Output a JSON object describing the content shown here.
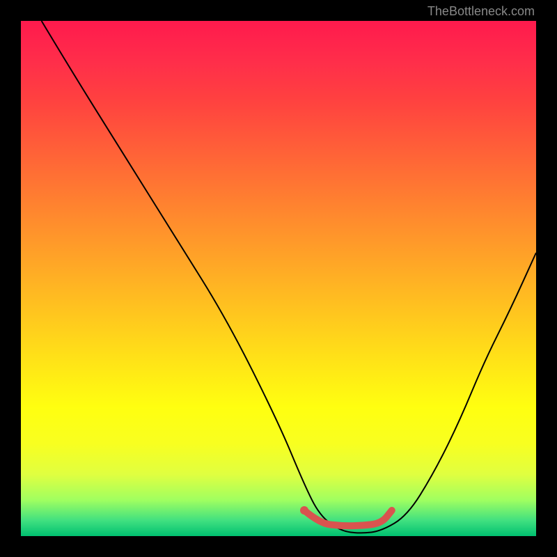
{
  "attribution": "TheBottleneck.com",
  "chart_data": {
    "type": "line",
    "title": "",
    "xlabel": "",
    "ylabel": "",
    "xlim": [
      0,
      100
    ],
    "ylim": [
      0,
      100
    ],
    "series": [
      {
        "name": "bottleneck-curve",
        "x": [
          4,
          10,
          20,
          30,
          40,
          50,
          55,
          58,
          62,
          66,
          70,
          75,
          80,
          85,
          90,
          95,
          100
        ],
        "y": [
          100,
          90,
          74,
          58,
          42,
          22,
          10,
          4,
          1,
          0.5,
          1,
          4,
          12,
          22,
          34,
          44,
          55
        ],
        "color": "#000000"
      },
      {
        "name": "optimal-range-marker",
        "x": [
          55,
          58,
          62,
          66,
          70,
          72
        ],
        "y": [
          5,
          2.5,
          2,
          2,
          2.5,
          5
        ],
        "color": "#d9534f"
      }
    ],
    "gradient_stops": [
      {
        "pos": 0,
        "color": "#ff1a4d"
      },
      {
        "pos": 25,
        "color": "#ff6038"
      },
      {
        "pos": 50,
        "color": "#ffc020"
      },
      {
        "pos": 75,
        "color": "#ffff10"
      },
      {
        "pos": 93,
        "color": "#a0ff60"
      },
      {
        "pos": 100,
        "color": "#00c070"
      }
    ]
  }
}
